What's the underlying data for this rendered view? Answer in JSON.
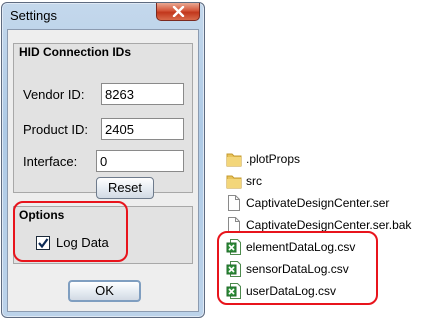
{
  "window": {
    "title": "Settings",
    "close_icon": "close-icon"
  },
  "hid_group": {
    "title": "HID Connection IDs",
    "vendor_label": "Vendor ID:",
    "vendor_value": "8263",
    "product_label": "Product ID:",
    "product_value": "2405",
    "interface_label": "Interface:",
    "interface_value": "0",
    "reset_label": "Reset"
  },
  "options_group": {
    "title": "Options",
    "log_data_label": "Log Data",
    "log_data_checked": true
  },
  "ok_label": "OK",
  "highlight_color": "#e8141c",
  "files": [
    {
      "name": ".plotProps",
      "icon": "folder-icon"
    },
    {
      "name": "src",
      "icon": "folder-icon"
    },
    {
      "name": "CaptivateDesignCenter.ser",
      "icon": "file-icon"
    },
    {
      "name": "CaptivateDesignCenter.ser.bak",
      "icon": "file-icon"
    },
    {
      "name": "elementDataLog.csv",
      "icon": "excel-csv-icon"
    },
    {
      "name": "sensorDataLog.csv",
      "icon": "excel-csv-icon"
    },
    {
      "name": "userDataLog.csv",
      "icon": "excel-csv-icon"
    }
  ]
}
